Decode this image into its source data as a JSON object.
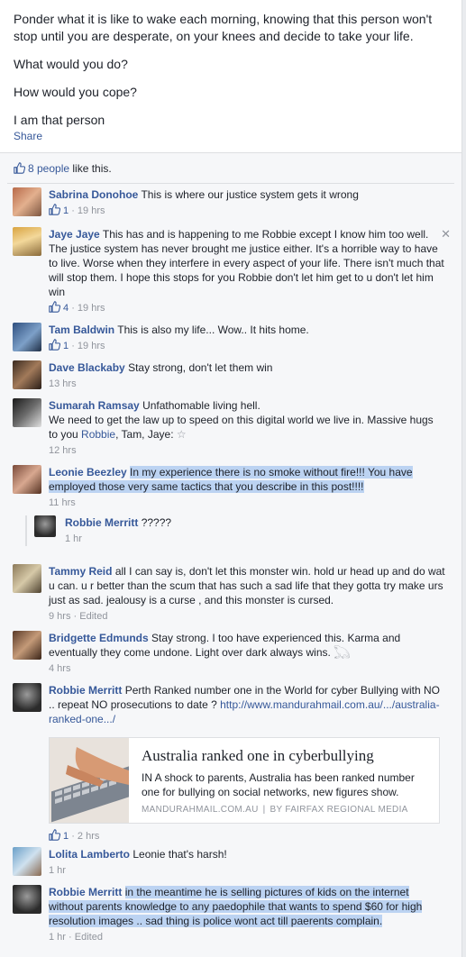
{
  "post": {
    "paragraphs": [
      "Ponder what it is like to wake each morning, knowing that this person won't stop until you are desperate, on your knees and decide to take your life.",
      "What would you do?",
      "How would you cope?",
      "I am that person"
    ],
    "share_label": "Share"
  },
  "likes": {
    "link": "8 people",
    "suffix": " like this."
  },
  "comments": [
    {
      "name": "Sabrina Donohoe",
      "text": "This is where our justice system gets it wrong",
      "likes": "1",
      "time": "19 hrs"
    },
    {
      "name": "Jaye Jaye",
      "text": "This has and is happening to me Robbie except I know him too well. The justice system has never brought me justice either. It's a horrible way to have to live. Worse when they interfere in every aspect of your life. There isn't much that will stop them. I hope this stops for you Robbie don't let him get to u don't let him win",
      "likes": "4",
      "time": "19 hrs",
      "close": "✕"
    },
    {
      "name": "Tam Baldwin",
      "text": "This is also my life... Wow.. It hits home.",
      "likes": "1",
      "time": "19 hrs"
    },
    {
      "name": "Dave Blackaby",
      "text": "Stay strong, don't let them win",
      "time": "13 hrs"
    },
    {
      "name": "Sumarah Ramsay",
      "text_a": "Unfathomable living hell.",
      "text_b": "We need to get the law up to speed on this digital world we live in. Massive hugs to you ",
      "mention": "Robbie",
      "text_c": ", Tam, Jaye:",
      "emoji": "☆",
      "time": "12 hrs"
    },
    {
      "name": "Leonie Beezley",
      "text": "In my experience there is no smoke without fire!!! You have employed those very same tactics that you describe in this post!!!!",
      "time": "11 hrs"
    },
    {
      "name": "Robbie Merritt",
      "text": "?????",
      "time": "1 hr"
    },
    {
      "name": "Tammy Reid",
      "text": "all I can say is, don't let this monster win. hold ur head up and do wat u can. u r better than the scum that has such a sad life that they gotta try make urs just as sad. jealousy is a curse , and this monster is cursed.",
      "time": "9 hrs",
      "edited": "Edited"
    },
    {
      "name": "Bridgette Edmunds",
      "text": "Stay strong. I too have experienced this. Karma and eventually they come undone. Light over dark always wins.",
      "emoji": "𓆏",
      "time": "4 hrs"
    },
    {
      "name": "Robbie Merritt",
      "text": "Perth Ranked number one in the World for cyber Bullying with NO .. repeat NO prosecutions to date ?",
      "url": "http://www.mandurahmail.com.au/.../australia-ranked-one.../",
      "likes": "1",
      "time": "2 hrs"
    },
    {
      "name": "Lolita Lamberto",
      "text": "Leonie that's harsh!",
      "time": "1 hr"
    },
    {
      "name": "Robbie Merritt",
      "text": "in the meantime he is selling pictures of kids on the internet without parents knowledge to any paedophile that wants to spend $60 for high resolution images .. sad thing is police wont act till paerents complain.",
      "time": "1 hr",
      "edited": "Edited"
    }
  ],
  "card": {
    "title": "Australia ranked one in cyberbullying",
    "description": "IN A shock to parents, Australia has been ranked number one for bullying on social networks, new figures show.",
    "source": "MANDURAHMAIL.COM.AU",
    "separator": "|",
    "byline": "BY FAIRFAX REGIONAL MEDIA"
  },
  "meta": {
    "dot": "·"
  },
  "colors": {
    "link": "#365899",
    "highlight": "#bcd3f2",
    "meta": "#90949c",
    "background": "#e9ebee"
  },
  "icons": {
    "like": "thumbs-up-icon"
  }
}
